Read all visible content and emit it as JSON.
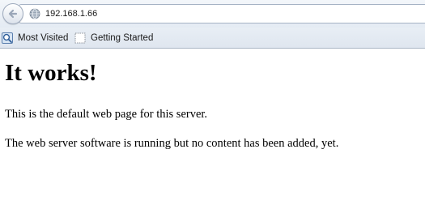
{
  "browser": {
    "url": "192.168.1.66",
    "bookmarks": [
      {
        "label": "Most Visited",
        "icon": "most-visited-icon"
      },
      {
        "label": "Getting Started",
        "icon": "page-icon"
      }
    ]
  },
  "page": {
    "heading": "It works!",
    "paragraphs": [
      "This is the default web page for this server.",
      "The web server software is running but no content has been added, yet."
    ]
  }
}
